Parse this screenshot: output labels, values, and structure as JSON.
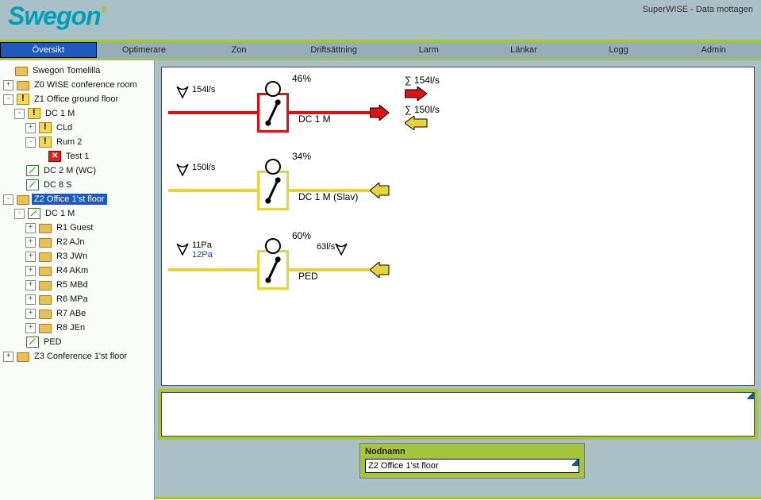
{
  "header": {
    "status": "SuperWISE - Data mottagen"
  },
  "nav": {
    "items": [
      "Översikt",
      "Optimerare",
      "Zon",
      "Driftsättning",
      "Larm",
      "Länkar",
      "Logg",
      "Admin"
    ],
    "selected": 0
  },
  "tree": [
    {
      "d": 0,
      "exp": "",
      "ico": "folder",
      "label": "Swegon Tomelilla"
    },
    {
      "d": 0,
      "exp": "+",
      "ico": "folder",
      "label": "Z0 WISE conference room"
    },
    {
      "d": 0,
      "exp": "-",
      "ico": "warn",
      "label": "Z1 Office ground floor"
    },
    {
      "d": 1,
      "exp": "-",
      "ico": "warn",
      "label": "DC 1 M"
    },
    {
      "d": 2,
      "exp": "+",
      "ico": "warn",
      "label": "CLd"
    },
    {
      "d": 2,
      "exp": "-",
      "ico": "warn",
      "label": "Rum 2"
    },
    {
      "d": 3,
      "exp": "",
      "ico": "err",
      "label": "Test 1"
    },
    {
      "d": 1,
      "exp": "",
      "ico": "ok",
      "label": "DC 2 M (WC)"
    },
    {
      "d": 1,
      "exp": "",
      "ico": "ok",
      "label": "DC 8 S"
    },
    {
      "d": 0,
      "exp": "-",
      "ico": "folder",
      "label": "Z2 Office 1'st floor",
      "sel": true
    },
    {
      "d": 1,
      "exp": "-",
      "ico": "ok",
      "label": "DC 1 M"
    },
    {
      "d": 2,
      "exp": "+",
      "ico": "folder",
      "label": "R1 Guest"
    },
    {
      "d": 2,
      "exp": "+",
      "ico": "folder",
      "label": "R2 AJn"
    },
    {
      "d": 2,
      "exp": "+",
      "ico": "folder",
      "label": "R3 JWn"
    },
    {
      "d": 2,
      "exp": "+",
      "ico": "folder",
      "label": "R4 AKm"
    },
    {
      "d": 2,
      "exp": "+",
      "ico": "folder",
      "label": "R5 MBd"
    },
    {
      "d": 2,
      "exp": "+",
      "ico": "folder",
      "label": "R6 MPa"
    },
    {
      "d": 2,
      "exp": "+",
      "ico": "folder",
      "label": "R7 ABe"
    },
    {
      "d": 2,
      "exp": "+",
      "ico": "folder",
      "label": "R8 JEn"
    },
    {
      "d": 1,
      "exp": "",
      "ico": "ok",
      "label": "PED"
    },
    {
      "d": 0,
      "exp": "+",
      "ico": "folder",
      "label": "Z3 Conference 1'st floor"
    }
  ],
  "diagram": {
    "row1": {
      "antenna": "154l/s",
      "pct": "46%",
      "name": "DC 1 M",
      "sum_top": "∑ 154l/s",
      "sum_bot": "∑ 150l/s"
    },
    "row2": {
      "antenna": "150l/s",
      "pct": "34%",
      "name": "DC 1 M (Slav)"
    },
    "row3": {
      "antenna_top": "11Pa",
      "antenna_sub": "12Pa",
      "pct": "60%",
      "mid": "63l/s",
      "name": "PED"
    }
  },
  "nodnamn": {
    "title": "Nodnamn",
    "value": "Z2 Office 1'st floor"
  }
}
